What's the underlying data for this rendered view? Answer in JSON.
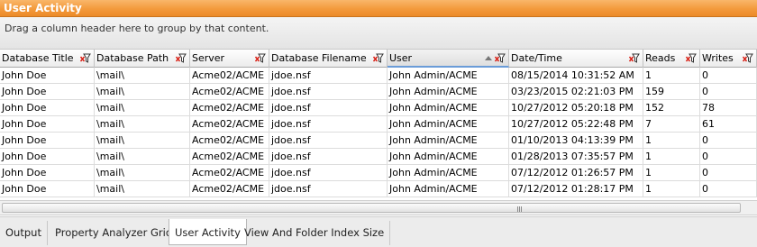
{
  "panel": {
    "title": "User Activity",
    "group_hint": "Drag a column header here to group by that content."
  },
  "columns": [
    {
      "label": "Database Title",
      "icon": "filter-clear-icon",
      "sorted": false
    },
    {
      "label": "Database Path",
      "icon": "filter-clear-icon",
      "sorted": false
    },
    {
      "label": "Server",
      "icon": "filter-clear-icon",
      "sorted": false
    },
    {
      "label": "Database Filename",
      "icon": "filter-clear-icon",
      "sorted": false
    },
    {
      "label": "User",
      "icon": "filter-clear-icon",
      "sorted": true,
      "sort_direction": "ascending"
    },
    {
      "label": "Date/Time",
      "icon": "filter-clear-icon",
      "sorted": false
    },
    {
      "label": "Reads",
      "icon": "filter-clear-icon",
      "sorted": false
    },
    {
      "label": "Writes",
      "icon": "filter-clear-icon",
      "sorted": false
    }
  ],
  "rows": [
    [
      "John Doe",
      "\\mail\\",
      "Acme02/ACME",
      "jdoe.nsf",
      "John Admin/ACME",
      "08/15/2014 10:31:52 AM",
      "1",
      "0"
    ],
    [
      "John Doe",
      "\\mail\\",
      "Acme02/ACME",
      "jdoe.nsf",
      "John Admin/ACME",
      "03/23/2015 02:21:03 PM",
      "159",
      "0"
    ],
    [
      "John Doe",
      "\\mail\\",
      "Acme02/ACME",
      "jdoe.nsf",
      "John Admin/ACME",
      "10/27/2012 05:20:18 PM",
      "152",
      "78"
    ],
    [
      "John Doe",
      "\\mail\\",
      "Acme02/ACME",
      "jdoe.nsf",
      "John Admin/ACME",
      "10/27/2012 05:22:48 PM",
      "7",
      "61"
    ],
    [
      "John Doe",
      "\\mail\\",
      "Acme02/ACME",
      "jdoe.nsf",
      "John Admin/ACME",
      "01/10/2013 04:13:39 PM",
      "1",
      "0"
    ],
    [
      "John Doe",
      "\\mail\\",
      "Acme02/ACME",
      "jdoe.nsf",
      "John Admin/ACME",
      "01/28/2013 07:35:57 PM",
      "1",
      "0"
    ],
    [
      "John Doe",
      "\\mail\\",
      "Acme02/ACME",
      "jdoe.nsf",
      "John Admin/ACME",
      "07/12/2012 01:26:57 PM",
      "1",
      "0"
    ],
    [
      "John Doe",
      "\\mail\\",
      "Acme02/ACME",
      "jdoe.nsf",
      "John Admin/ACME",
      "07/12/2012 01:28:17 PM",
      "1",
      "0"
    ]
  ],
  "tabs": [
    {
      "label": "Output",
      "active": false
    },
    {
      "label": "Property Analyzer Grid",
      "active": false
    },
    {
      "label": "User Activity",
      "active": true
    },
    {
      "label": "View And Folder Index Size",
      "active": false
    }
  ],
  "colors": {
    "title_bar": "#f39a3c",
    "title_text": "#ffffff",
    "sort_indicator": "#6a9cd8",
    "filter_icon_red": "#d9261c"
  }
}
